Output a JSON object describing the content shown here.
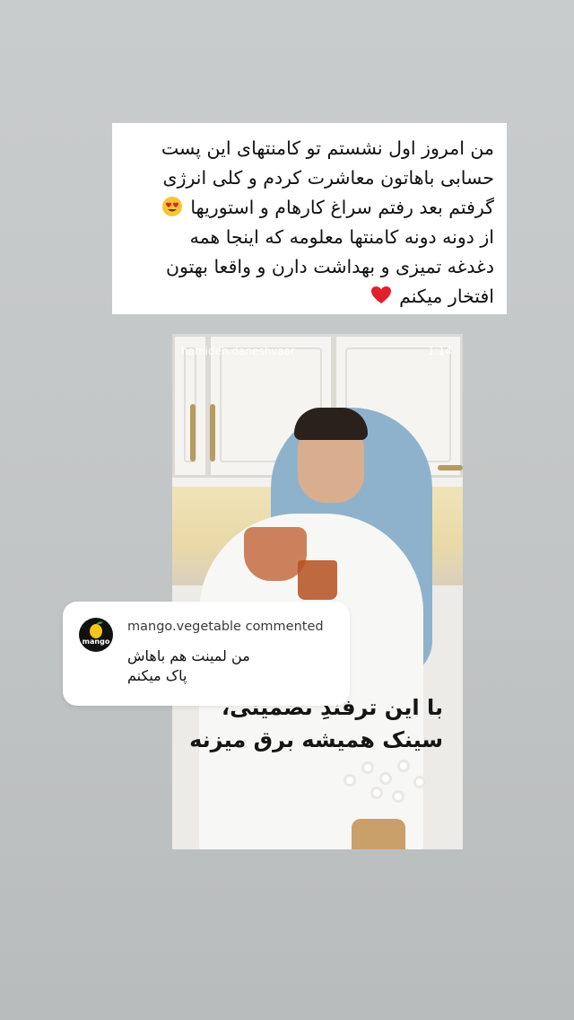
{
  "caption": {
    "lines": [
      "من امروز اول نشستم تو کامنتهای این پست",
      "حسابی باهاتون معاشرت کردم و کلی انرژی",
      "گرفتم بعد رفتم سراغ کارهام و استوریها",
      "از دونه دونه کامنتها معلومه که اینجا همه",
      "دغدغه تمیزی و بهداشت دارن و واقعا بهتون",
      "افتخار میکنم"
    ],
    "emoji_1": "heart-eyes-emoji",
    "emoji_2": "red-heart-emoji"
  },
  "video": {
    "username": "hamideh.daneshvaar",
    "time": "1:14",
    "overlay_lines": [
      "با این ترفندِ تضمینی،",
      "سینک همیشه برق میزنه"
    ]
  },
  "comment": {
    "avatar_label": "mango",
    "user_line": "mango.vegetable commented",
    "text_lines": [
      "من لمینت هم باهاش",
      "پاک میکنم"
    ]
  },
  "colors": {
    "background": "#c6c9c9",
    "card": "#ffffff",
    "heart": "#e0202d",
    "emoji_face": "#f7c531",
    "brand_mango": "#f5c518"
  }
}
